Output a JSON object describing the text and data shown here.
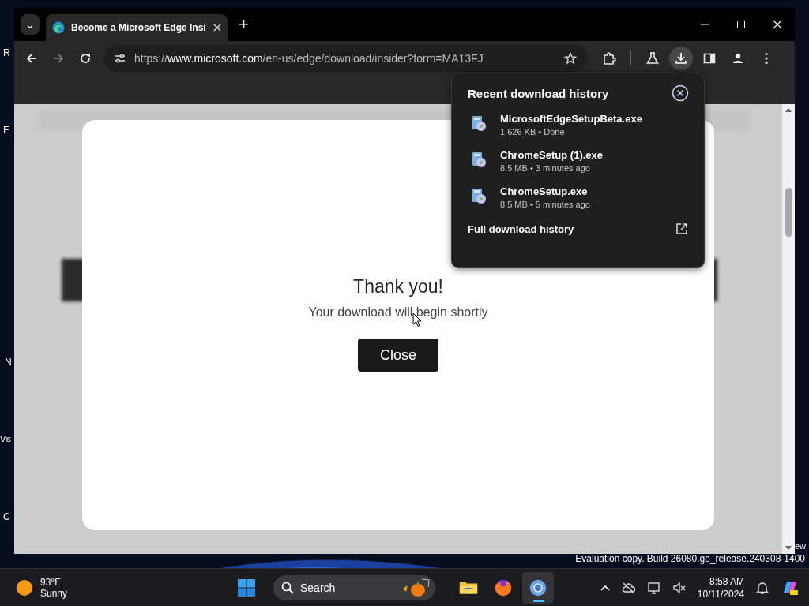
{
  "desktop": {
    "icon_labels": [
      "R",
      "E",
      "N",
      "Vis",
      "C"
    ],
    "right_label": "ew",
    "watermark": "Evaluation copy. Build 26080.ge_release.240308-1400"
  },
  "browser": {
    "tab_list_button": "⌄",
    "tabs": [
      {
        "title": "Become a Microsoft Edge Insi",
        "selected": true
      }
    ],
    "new_tab": "+",
    "address": {
      "scheme": "https://",
      "host": "www.microsoft.com",
      "path": "/en-us/edge/download/insider?form=MA13FJ"
    }
  },
  "downloads_panel": {
    "title": "Recent download history",
    "items": [
      {
        "name": "MicrosoftEdgeSetupBeta.exe",
        "details": "1,626 KB • Done"
      },
      {
        "name": "ChromeSetup (1).exe",
        "details": "8.5 MB • 3 minutes ago"
      },
      {
        "name": "ChromeSetup.exe",
        "details": "8.5 MB • 5 minutes ago"
      }
    ],
    "footer": "Full download history"
  },
  "dialog": {
    "heading": "Thank you!",
    "message": "Your download will begin shortly",
    "button": "Close"
  },
  "taskbar": {
    "weather": {
      "temperature": "93°F",
      "condition": "Sunny"
    },
    "search": {
      "placeholder": "Search"
    },
    "apps": [
      {
        "kind": "folder",
        "active": false
      },
      {
        "kind": "firefox",
        "active": false
      },
      {
        "kind": "chrome",
        "active": true
      }
    ],
    "time": "8:58 AM",
    "date": "10/11/2024"
  }
}
